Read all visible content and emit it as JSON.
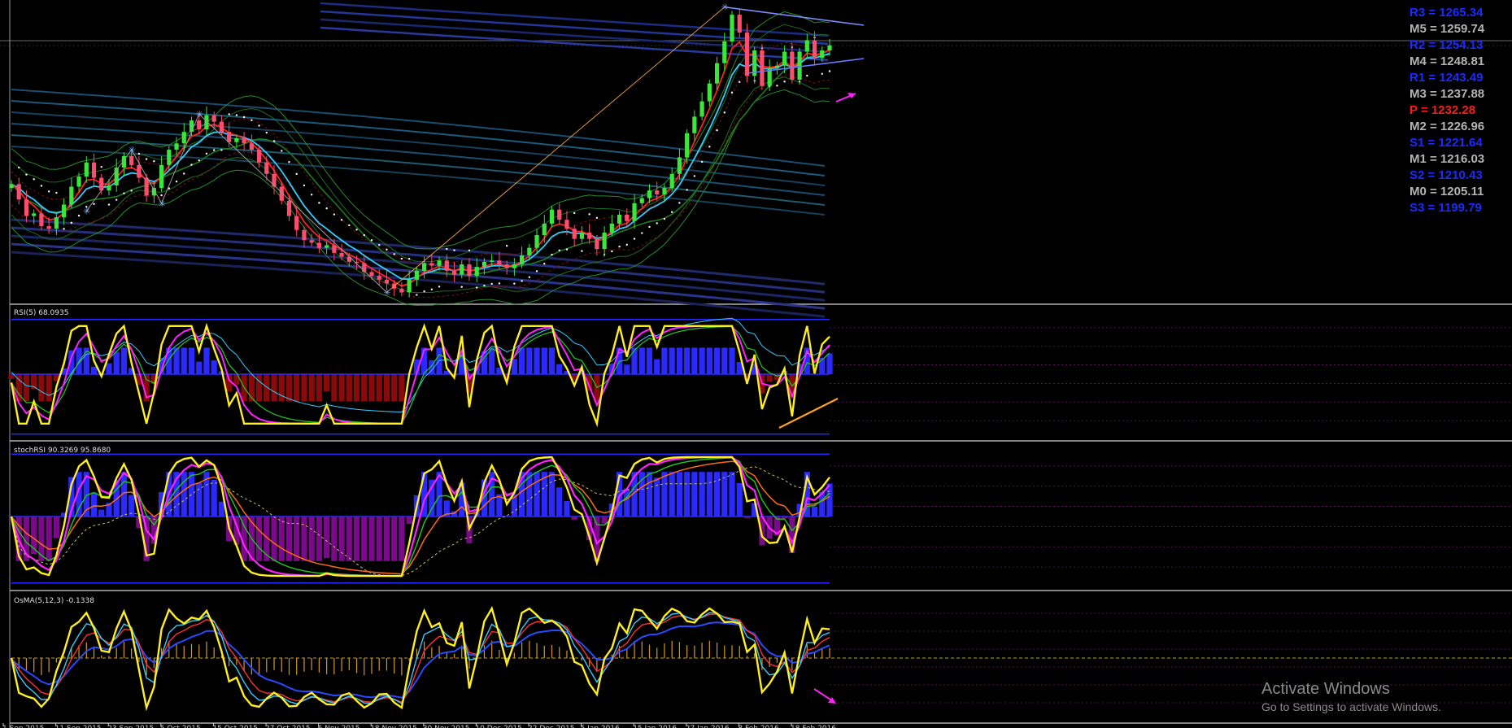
{
  "chart_data": {
    "type": "line",
    "title": "",
    "pivot_levels": [
      {
        "label": "R3 = 1265.34",
        "color": "#1a2bff"
      },
      {
        "label": "M5 = 1259.74",
        "color": "#b4b4b4"
      },
      {
        "label": "R2 = 1254.13",
        "color": "#1a2bff"
      },
      {
        "label": "M4 = 1248.81",
        "color": "#b4b4b4"
      },
      {
        "label": "R1 = 1243.49",
        "color": "#1a2bff"
      },
      {
        "label": "M3 = 1237.88",
        "color": "#b4b4b4"
      },
      {
        "label": "P   = 1232.28",
        "color": "#ff1a1a"
      },
      {
        "label": "M2 = 1226.96",
        "color": "#b4b4b4"
      },
      {
        "label": "S1 = 1221.64",
        "color": "#1a2bff"
      },
      {
        "label": "M1 = 1216.03",
        "color": "#b4b4b4"
      },
      {
        "label": "S2 = 1210.43",
        "color": "#1a2bff"
      },
      {
        "label": "M0 = 1205.11",
        "color": "#b4b4b4"
      },
      {
        "label": "S3 = 1199.79",
        "color": "#1a2bff"
      }
    ],
    "date_labels": [
      "1 Sep 2015",
      "11 Sep 2015",
      "23 Sep 2015",
      "5 Oct 2015",
      "15 Oct 2015",
      "27 Oct 2015",
      "6 Nov 2015",
      "18 Nov 2015",
      "30 Nov 2015",
      "10 Dec 2015",
      "22 Dec 2015",
      "5 Jan 2016",
      "15 Jan 2016",
      "27 Jan 2016",
      "8 Feb 2016",
      "18 Feb 2016"
    ],
    "panes": [
      {
        "name": "price",
        "type": "candlestick"
      },
      {
        "name": "RSI",
        "label": "RSI(5) 68.0935",
        "value": 68.0935
      },
      {
        "name": "stochRSI",
        "label": "stochRSI 90.3269 95.8680",
        "values": [
          90.3269,
          95.868
        ]
      },
      {
        "name": "OsMA",
        "label": "OsMA(5,12,3) -0.1338",
        "value": -0.1338
      }
    ],
    "price_closes": [
      1133,
      1121,
      1108,
      1110,
      1100,
      1098,
      1107,
      1117,
      1131,
      1139,
      1150,
      1138,
      1128,
      1132,
      1146,
      1155,
      1148,
      1138,
      1124,
      1130,
      1148,
      1160,
      1165,
      1174,
      1183,
      1176,
      1187,
      1182,
      1174,
      1166,
      1169,
      1165,
      1160,
      1150,
      1141,
      1131,
      1120,
      1108,
      1097,
      1089,
      1087,
      1083,
      1085,
      1079,
      1076,
      1072,
      1071,
      1064,
      1061,
      1058,
      1055,
      1051,
      1048,
      1058,
      1065,
      1071,
      1069,
      1073,
      1065,
      1062,
      1070,
      1061,
      1068,
      1072,
      1073,
      1070,
      1067,
      1070,
      1077,
      1083,
      1093,
      1102,
      1113,
      1105,
      1098,
      1090,
      1095,
      1090,
      1082,
      1095,
      1102,
      1109,
      1104,
      1118,
      1122,
      1128,
      1125,
      1130,
      1141,
      1154,
      1173,
      1186,
      1198,
      1212,
      1228,
      1245,
      1266,
      1252,
      1218,
      1238,
      1210,
      1224,
      1226,
      1237,
      1215,
      1237,
      1246,
      1232,
      1238,
      1242
    ]
  },
  "windows_notice": {
    "title": "Activate Windows",
    "subtitle": "Go to Settings to activate Windows."
  }
}
